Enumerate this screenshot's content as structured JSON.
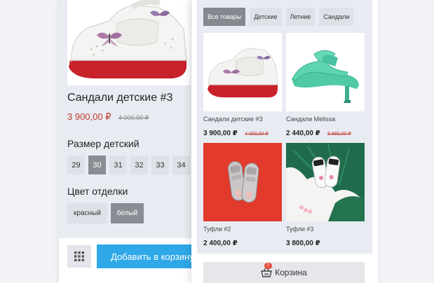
{
  "product": {
    "title": "Сандали детские #3",
    "price": "3 900,00 ₽",
    "old_price": "4 000,00 ₽",
    "size_label": "Размер детский",
    "sizes": [
      "29",
      "30",
      "31",
      "32",
      "33",
      "34"
    ],
    "selected_size": "30",
    "color_label": "Цвет отделки",
    "colors": [
      "красный",
      "белый"
    ],
    "selected_color": "белый",
    "add_to_cart": "Добавить в корзину"
  },
  "catalog": {
    "tabs": [
      "Все товары",
      "Детские",
      "Летние",
      "Сандали"
    ],
    "active_tab": "Все товары",
    "items": [
      {
        "title": "Сандали детские #3",
        "price": "3 900,00 ₽",
        "old_price": "4 000,00 ₽"
      },
      {
        "title": "Сандали Melissa",
        "price": "2 440,00 ₽",
        "old_price": "5 880,00 ₽"
      },
      {
        "title": "Туфли #2",
        "price": "2 400,00 ₽",
        "old_price": ""
      },
      {
        "title": "Туфли #3",
        "price": "3 800,00 ₽",
        "old_price": ""
      }
    ]
  },
  "cart": {
    "label": "Корзина",
    "count": "1"
  },
  "colors": {
    "accent": "#2ea8e8",
    "price_red": "#c0392b",
    "selected_gray": "#8a8d93",
    "badge": "#e74c3c"
  },
  "icons": {
    "grid": "grid-icon",
    "cart": "basket-icon"
  }
}
